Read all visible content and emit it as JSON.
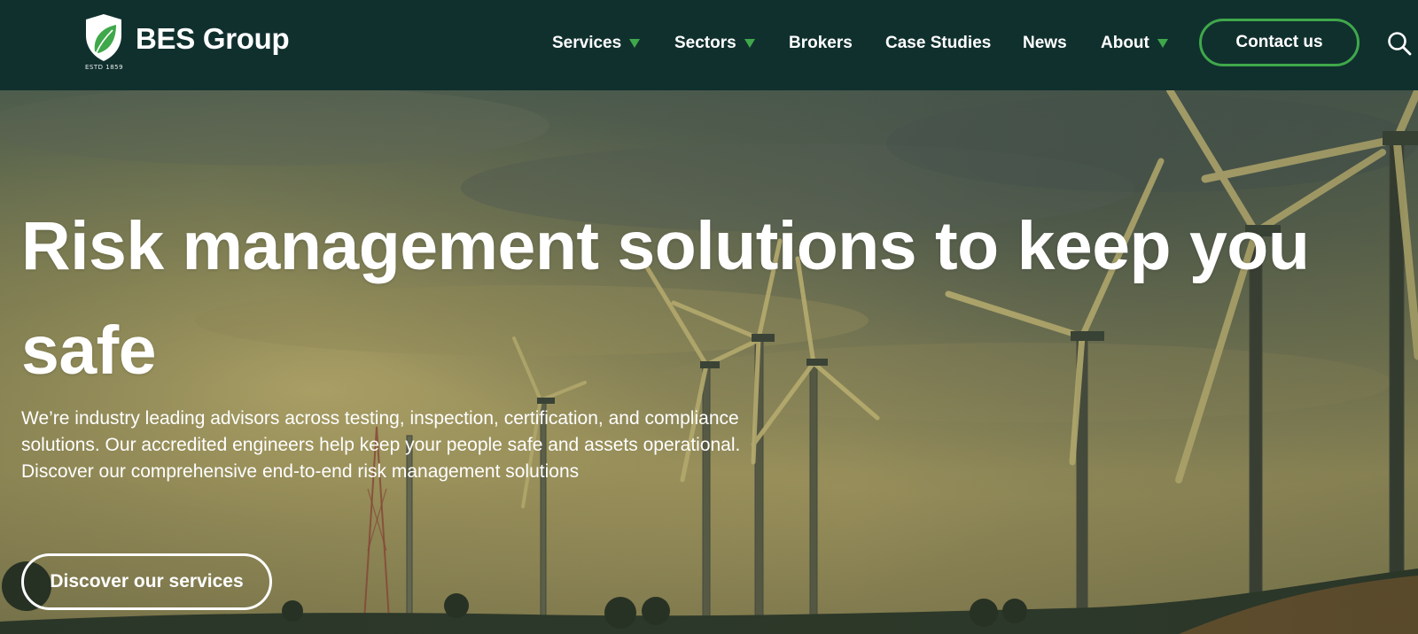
{
  "brand": {
    "name": "BES Group",
    "established": "ESTD 1859",
    "colors": {
      "header_bg": "#10302e",
      "accent": "#3fa84a"
    }
  },
  "nav": {
    "items": [
      {
        "label": "Services",
        "has_dropdown": true
      },
      {
        "label": "Sectors",
        "has_dropdown": true
      },
      {
        "label": "Brokers",
        "has_dropdown": false
      },
      {
        "label": "Case Studies",
        "has_dropdown": false
      },
      {
        "label": "News",
        "has_dropdown": false
      },
      {
        "label": "About",
        "has_dropdown": true
      }
    ],
    "contact_label": "Contact us",
    "search_icon": "search-icon"
  },
  "hero": {
    "title": "Risk management solutions to keep you safe",
    "description": "We’re industry leading advisors across testing, inspection, certification, and compliance solutions. Our accredited engineers help keep your people safe and assets operational. Discover our comprehensive end-to-end risk management solutions",
    "cta_label": "Discover our services",
    "background": "wind-turbines-sunset-image"
  }
}
